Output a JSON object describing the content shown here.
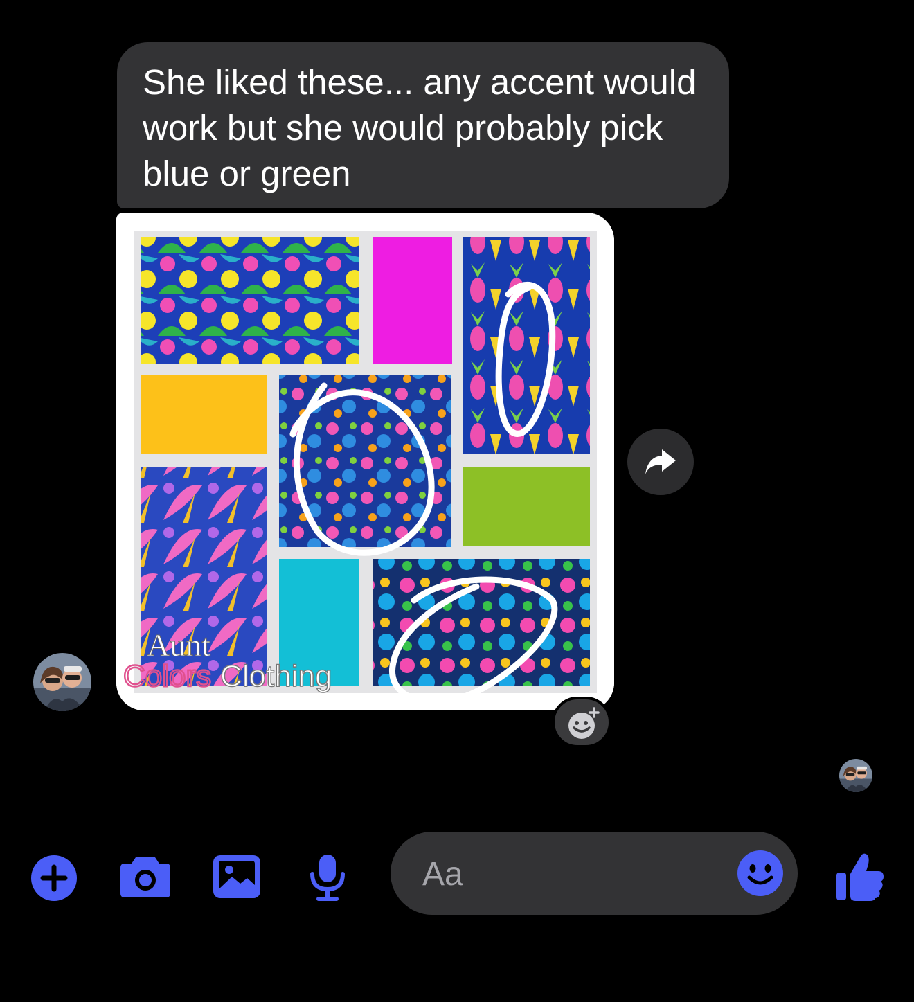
{
  "message": {
    "text": "She liked these... any accent would work but she would probably pick blue or green"
  },
  "attachment": {
    "image_description_icon": "pattern-collage-image",
    "watermark_line1": "Aunt",
    "watermark_line2_colored": "Colors",
    "watermark_line2_plain": "Clothing",
    "swatch_colors": [
      "#ee1de2",
      "#fdc119",
      "#8dc026",
      "#13bfd6"
    ]
  },
  "actions": {
    "forward_icon": "share-arrow-icon",
    "reaction_icon": "add-reaction-icon"
  },
  "toolbar": {
    "plus_icon": "plus-icon",
    "camera_icon": "camera-icon",
    "gallery_icon": "gallery-icon",
    "mic_icon": "microphone-icon",
    "like_icon": "thumbs-up-icon",
    "accent_color": "#4b5ef7"
  },
  "composer": {
    "placeholder": "Aa",
    "emoji_icon": "smiley-icon"
  }
}
